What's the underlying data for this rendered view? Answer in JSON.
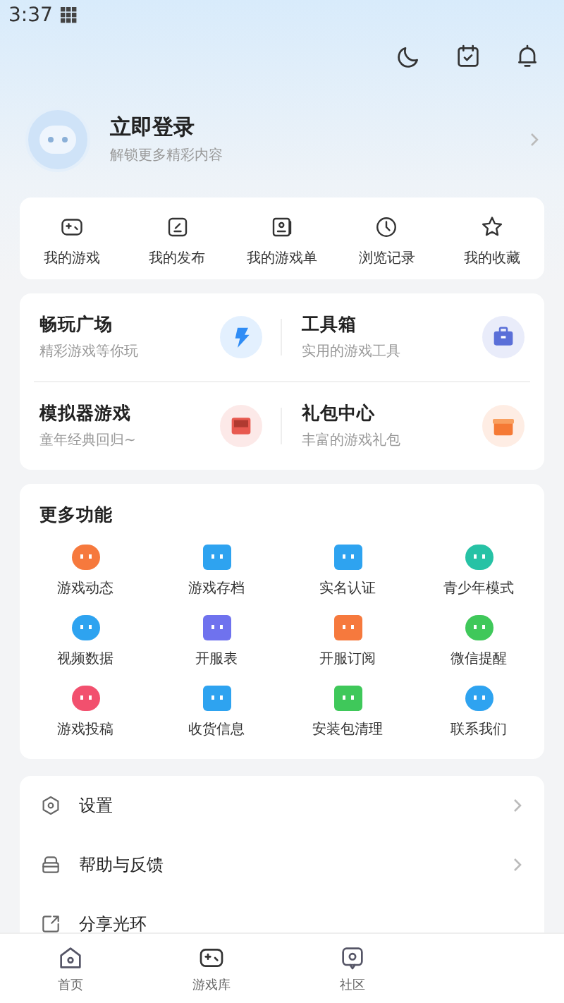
{
  "status_bar": {
    "time": "3:37"
  },
  "profile": {
    "title": "立即登录",
    "subtitle": "解锁更多精彩内容"
  },
  "quick_links": [
    {
      "label": "我的游戏",
      "kind": "gamepad"
    },
    {
      "label": "我的发布",
      "kind": "publish"
    },
    {
      "label": "我的游戏单",
      "kind": "list"
    },
    {
      "label": "浏览记录",
      "kind": "clock"
    },
    {
      "label": "我的收藏",
      "kind": "star"
    }
  ],
  "featured": [
    {
      "title": "畅玩广场",
      "subtitle": "精彩游戏等你玩",
      "color": "#2f8cf5"
    },
    {
      "title": "工具箱",
      "subtitle": "实用的游戏工具",
      "color": "#5a6fd8"
    },
    {
      "title": "模拟器游戏",
      "subtitle": "童年经典回归~",
      "color": "#e85a50"
    },
    {
      "title": "礼包中心",
      "subtitle": "丰富的游戏礼包",
      "color": "#f57a35"
    }
  ],
  "more_functions": {
    "title": "更多功能",
    "items": [
      {
        "label": "游戏动态",
        "color": "#f6793d"
      },
      {
        "label": "游戏存档",
        "color": "#2ea3f0"
      },
      {
        "label": "实名认证",
        "color": "#2ea3f0"
      },
      {
        "label": "青少年模式",
        "color": "#26c2a5"
      },
      {
        "label": "视频数据",
        "color": "#2ea3f0"
      },
      {
        "label": "开服表",
        "color": "#6f72ee"
      },
      {
        "label": "开服订阅",
        "color": "#f6793d"
      },
      {
        "label": "微信提醒",
        "color": "#3fc85a"
      },
      {
        "label": "游戏投稿",
        "color": "#f2506e"
      },
      {
        "label": "收货信息",
        "color": "#2ea3f0"
      },
      {
        "label": "安装包清理",
        "color": "#3fc85a"
      },
      {
        "label": "联系我们",
        "color": "#2ea3f0"
      }
    ]
  },
  "settings": [
    {
      "label": "设置",
      "kind": "gear",
      "chevron": true
    },
    {
      "label": "帮助与反馈",
      "kind": "help",
      "chevron": true
    },
    {
      "label": "分享光环",
      "kind": "share",
      "chevron": false
    }
  ],
  "bottom_nav": [
    {
      "label": "首页",
      "kind": "home"
    },
    {
      "label": "游戏库",
      "kind": "gamepad"
    },
    {
      "label": "社区",
      "kind": "chat"
    }
  ]
}
